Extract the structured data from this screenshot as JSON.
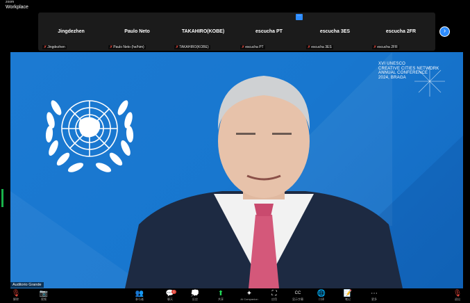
{
  "window": {
    "app_small": "zoom",
    "app_name": "Workplace"
  },
  "strip": {
    "participants": [
      {
        "name": "Jingdezhen",
        "tag": "Jingdezhen"
      },
      {
        "name": "Paulo Neto",
        "tag": "Paulo Neto (he/him)"
      },
      {
        "name": "TAKAHIRO(KOBE)",
        "tag": "TAKAHIRO(KOBE)"
      },
      {
        "name": "escucha PT",
        "tag": "escucha PT"
      },
      {
        "name": "escucha 3ES",
        "tag": "escucha 3ES"
      },
      {
        "name": "escucha 2FR",
        "tag": "escucha 2FR"
      }
    ],
    "tab_label": "···",
    "next_label": "›"
  },
  "video": {
    "conference_lines": [
      "XVI UNESCO",
      "CREATIVE CITIES NETWORK",
      "ANNUAL CONFERENCE",
      "2024, BRAGA"
    ],
    "speaker_tag": "Auditorio Grande"
  },
  "toolbar": {
    "items": [
      {
        "icon": "🎙",
        "label": "解除",
        "state": "muted"
      },
      {
        "icon": "📷",
        "label": "视频",
        "state": "off"
      },
      {
        "icon": "👥",
        "label": "参与者",
        "count": "46"
      },
      {
        "icon": "💬",
        "label": "聊天",
        "count": "1"
      },
      {
        "icon": "💭",
        "label": "反应"
      },
      {
        "icon": "⬆",
        "label": "共享"
      },
      {
        "icon": "✦",
        "label": "AI Companion"
      },
      {
        "icon": "⛶",
        "label": "应用"
      },
      {
        "icon": "CC",
        "label": "显示字幕"
      },
      {
        "icon": "🌐",
        "label": "口译"
      },
      {
        "icon": "📝",
        "label": "笔记"
      },
      {
        "icon": "⋯",
        "label": "更多"
      },
      {
        "icon": "🎙",
        "label": "退出"
      }
    ]
  },
  "colors": {
    "accent": "#2d8cff",
    "video_bg": "#1a75cd",
    "muted": "#e0463a",
    "share": "#23d959"
  }
}
